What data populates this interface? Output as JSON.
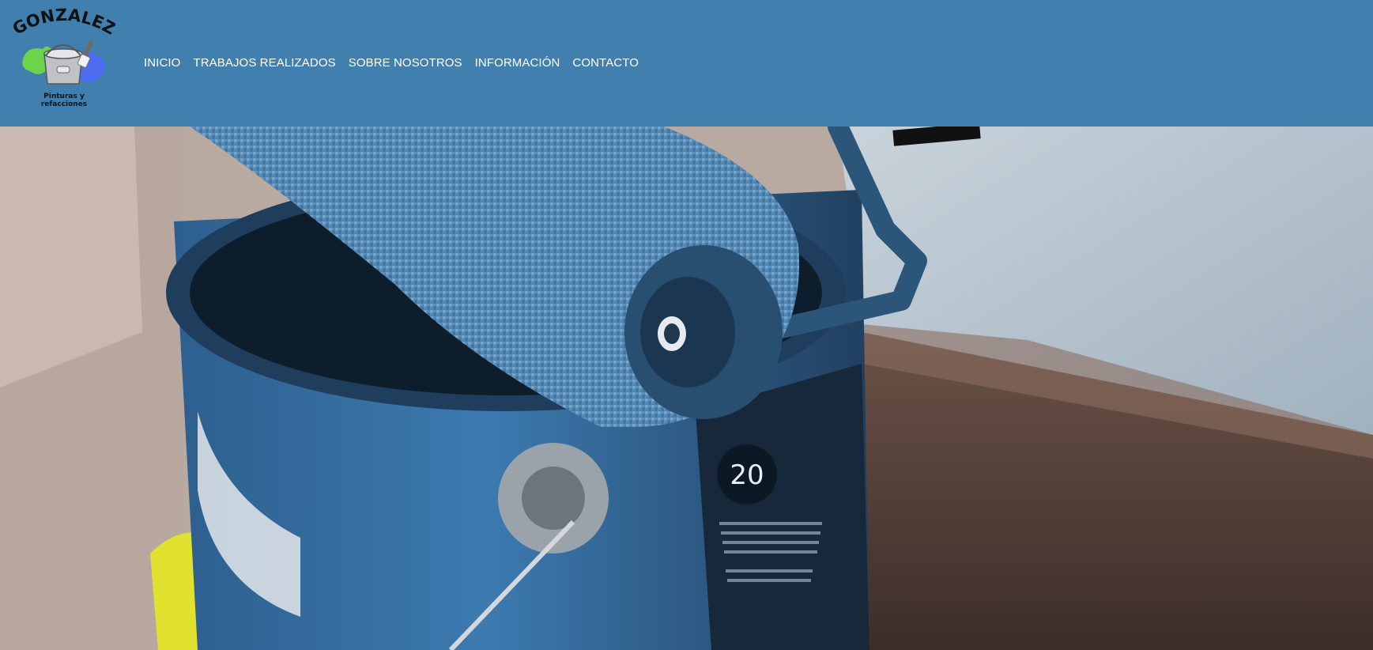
{
  "header": {
    "logo": {
      "brand_text": "GONZÁLEZ",
      "tagline_line1": "Pinturas y",
      "tagline_line2": "refacciones"
    },
    "nav": [
      {
        "label": "INICIO"
      },
      {
        "label": "TRABAJOS REALIZADOS"
      },
      {
        "label": "SOBRE NOSOTROS"
      },
      {
        "label": "INFORMACIÓN"
      },
      {
        "label": "CONTACTO"
      }
    ]
  },
  "hero": {
    "image": "paint-can-with-roller-photo",
    "can_label_text": "20"
  },
  "colors": {
    "header_bg": "#4180ae",
    "nav_text": "#ffffff",
    "paint_blue": "#3f79a8"
  }
}
